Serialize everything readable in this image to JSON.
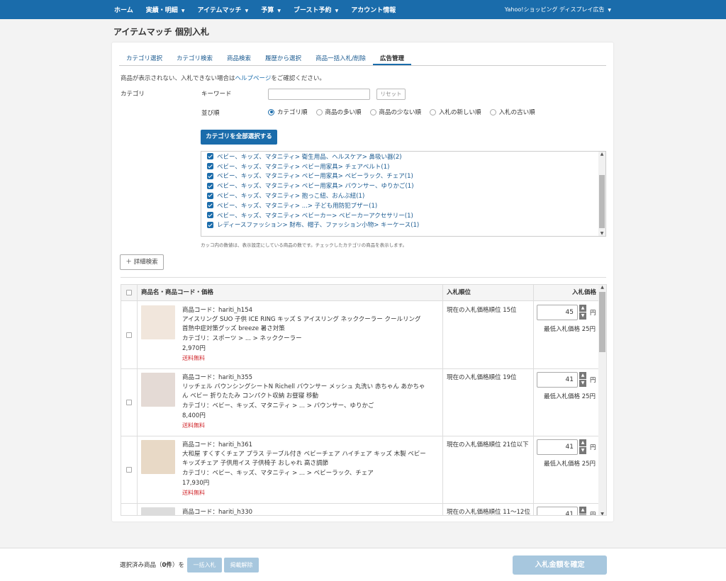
{
  "nav": {
    "items": [
      {
        "label": "ホーム",
        "caret": false
      },
      {
        "label": "実績・明細",
        "caret": true
      },
      {
        "label": "アイテムマッチ",
        "caret": true
      },
      {
        "label": "予算",
        "caret": true
      },
      {
        "label": "ブースト予約",
        "caret": true
      },
      {
        "label": "アカウント情報",
        "caret": false
      }
    ],
    "account_label": "Yahoo!ショッピング ディスプレイ広告"
  },
  "page_title": "アイテムマッチ 個別入札",
  "tabs": [
    {
      "label": "カテゴリ選択",
      "active": false
    },
    {
      "label": "カテゴリ検索",
      "active": false
    },
    {
      "label": "商品検索",
      "active": false
    },
    {
      "label": "履歴から選択",
      "active": false
    },
    {
      "label": "商品一括入札/削除",
      "active": false
    },
    {
      "label": "広告管理",
      "active": true
    }
  ],
  "notice": {
    "before": "商品が表示されない、入札できない場合は",
    "link": "ヘルプページ",
    "after": "をご確認ください。"
  },
  "filters": {
    "category_label": "カテゴリ",
    "keyword_label": "キーワード",
    "keyword_value": "",
    "reset_label": "リセット",
    "sort_label": "並び順",
    "sort_options": [
      {
        "label": "カテゴリ順",
        "selected": true
      },
      {
        "label": "商品の多い順",
        "selected": false
      },
      {
        "label": "商品の少ない順",
        "selected": false
      },
      {
        "label": "入札の新しい順",
        "selected": false
      },
      {
        "label": "入札の古い順",
        "selected": false
      }
    ],
    "select_all_label": "カテゴリを全部選択する"
  },
  "category_list": [
    "ベビー、キッズ、マタニティ> 衛生用品、ヘルスケア> 鼻吸い器(2)",
    "ベビー、キッズ、マタニティ> ベビー用家具> チェアベルト(1)",
    "ベビー、キッズ、マタニティ> ベビー用家具> ベビーラック、チェア(1)",
    "ベビー、キッズ、マタニティ> ベビー用家具> バウンサー、ゆりかご(1)",
    "ベビー、キッズ、マタニティ> 抱っこ紐、おんぶ紐(1)",
    "ベビー、キッズ、マタニティ> ...> 子ども用防犯ブザー(1)",
    "ベビー、キッズ、マタニティ> ベビーカー> ベビーカーアクセサリー(1)",
    "レディースファッション> 財布、帽子、ファッション小物> キーケース(1)"
  ],
  "category_note": "カッコ内の数値は、表示設定にしている商品の数です。チェックしたカテゴリの商品を表示します。",
  "detail_search_label": "詳細検索",
  "table": {
    "headers": {
      "product": "商品名・商品コード・価格",
      "rank": "入札順位",
      "price": "入札価格"
    },
    "rows": [
      {
        "code": "商品コード：hariti_h154",
        "name": "アイスリング SUO 子供 ICE RING キッズ S アイスリング ネッククーラー クールリング 首熱中症対策グッズ breeze 暑さ対策",
        "category": "カテゴリ：スポーツ > ... > ネッククーラー",
        "price": "2,970円",
        "shipping": "送料無料",
        "rank": "現在の入札価格順位 15位",
        "bid": "45",
        "yen": "円",
        "min_bid": "最低入札価格 25円",
        "thumb_color": "#f1e6dc"
      },
      {
        "code": "商品コード：hariti_h355",
        "name": "リッチェル バウンシングシートN Richell バウンサー メッシュ 丸洗い 赤ちゃん あかちゃん ベビー 折りたたみ コンパクト収納 お昼寝 移動",
        "category": "カテゴリ：ベビー、キッズ、マタニティ > ... > バウンサー、ゆりかご",
        "price": "8,400円",
        "shipping": "送料無料",
        "rank": "現在の入札価格順位 19位",
        "bid": "41",
        "yen": "円",
        "min_bid": "最低入札価格 25円",
        "thumb_color": "#e4dad5"
      },
      {
        "code": "商品コード：hariti_h361",
        "name": "大和屋 すくすくチェア プラス テーブル付き ベビーチェア ハイチェア キッズ 木製 ベビー キッズチェア 子供用イス 子供椅子 おしゃれ 高さ調節",
        "category": "カテゴリ：ベビー、キッズ、マタニティ > ... > ベビーラック、チェア",
        "price": "17,930円",
        "shipping": "送料無料",
        "rank": "現在の入札価格順位 21位以下",
        "bid": "41",
        "yen": "円",
        "min_bid": "最低入札価格 25円",
        "thumb_color": "#e8d9c6"
      },
      {
        "code": "商品コード：hariti_h330",
        "name": "",
        "category": "",
        "price": "",
        "shipping": "",
        "rank": "現在の入札価格順位 11〜12位",
        "bid": "41",
        "yen": "円",
        "min_bid": "",
        "thumb_color": "#dcdcdc"
      }
    ]
  },
  "bottom": {
    "selected_prefix": "選択済み商品（",
    "selected_count": "0件",
    "selected_suffix": "）を",
    "bulk_bid_label": "一括入札",
    "unpublish_label": "掲載解除",
    "confirm_label": "入札金額を確定"
  },
  "colors": {
    "brand": "#1a6cab",
    "disabled_button": "#a7c7de",
    "free_shipping": "#d0252a"
  }
}
